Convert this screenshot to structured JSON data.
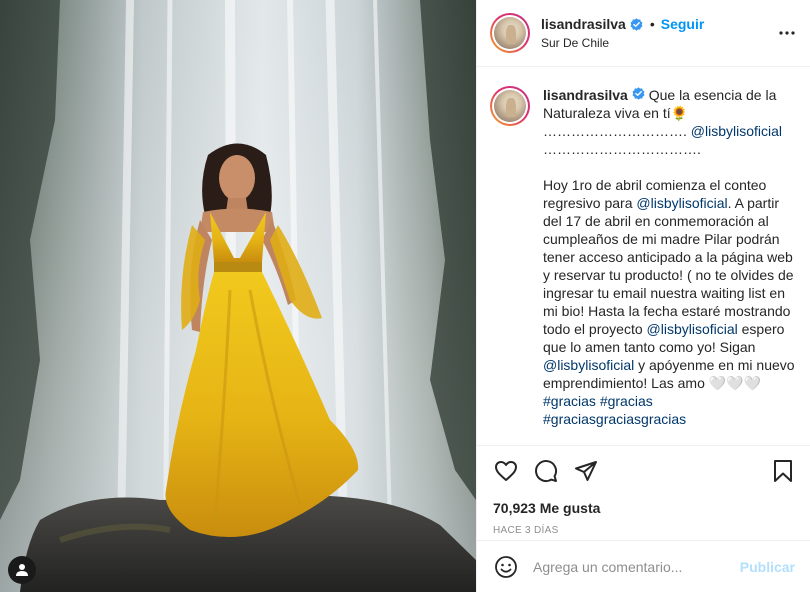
{
  "colors": {
    "accent": "#0095f6",
    "link": "#00376b",
    "muted": "#8e8e8e",
    "publish_disabled": "#b2dffc",
    "dress": "#e2b21a"
  },
  "post": {
    "photo_alt_icon": "user-tag-icon"
  },
  "header": {
    "username": "lisandrasilva",
    "separator": "•",
    "follow_label": "Seguir",
    "location": "Sur De Chile",
    "more_icon": "more-options-icon"
  },
  "caption": {
    "username": "lisandrasilva",
    "segments": [
      {
        "type": "text",
        "text": " Que la esencia de la Naturaleza viva en tí🌻\n…………………………. "
      },
      {
        "type": "mention",
        "text": "@lisbylisoficial"
      },
      {
        "type": "text",
        "text": "\n…………………………….\n\nHoy 1ro de abril comienza el conteo regresivo para "
      },
      {
        "type": "mention",
        "text": "@lisbylisoficial"
      },
      {
        "type": "text",
        "text": ". A partir del 17 de abril en conmemoración al cumpleaños de mi madre Pilar podrán tener acceso anticipado a la página web y reservar tu producto! ( no te olvides de ingresar tu email nuestra waiting list en mi bio! Hasta la fecha estaré mostrando todo el proyecto "
      },
      {
        "type": "mention",
        "text": "@lisbylisoficial"
      },
      {
        "type": "text",
        "text": " espero que lo amen tanto como yo! Sigan "
      },
      {
        "type": "mention",
        "text": "@lisbylisoficial"
      },
      {
        "type": "text",
        "text": " y apóyenme en mi nuevo emprendimiento! Las amo 🤍🤍🤍\n"
      },
      {
        "type": "hashtag",
        "text": "#gracias"
      },
      {
        "type": "text",
        "text": " "
      },
      {
        "type": "hashtag",
        "text": "#gracias"
      },
      {
        "type": "text",
        "text": "\n"
      },
      {
        "type": "hashtag",
        "text": "#graciasgraciasgracias"
      }
    ]
  },
  "actions": {
    "like_icon": "heart-icon",
    "comment_icon": "comment-icon",
    "share_icon": "share-icon",
    "save_icon": "bookmark-icon",
    "likes_count": "70,923",
    "likes_label": "Me gusta",
    "likes_text": "70,923 Me gusta",
    "timestamp": "HACE 3 DÍAS"
  },
  "comment": {
    "emoji_icon": "emoji-icon",
    "placeholder": "Agrega un comentario...",
    "value": "",
    "publish_label": "Publicar"
  }
}
